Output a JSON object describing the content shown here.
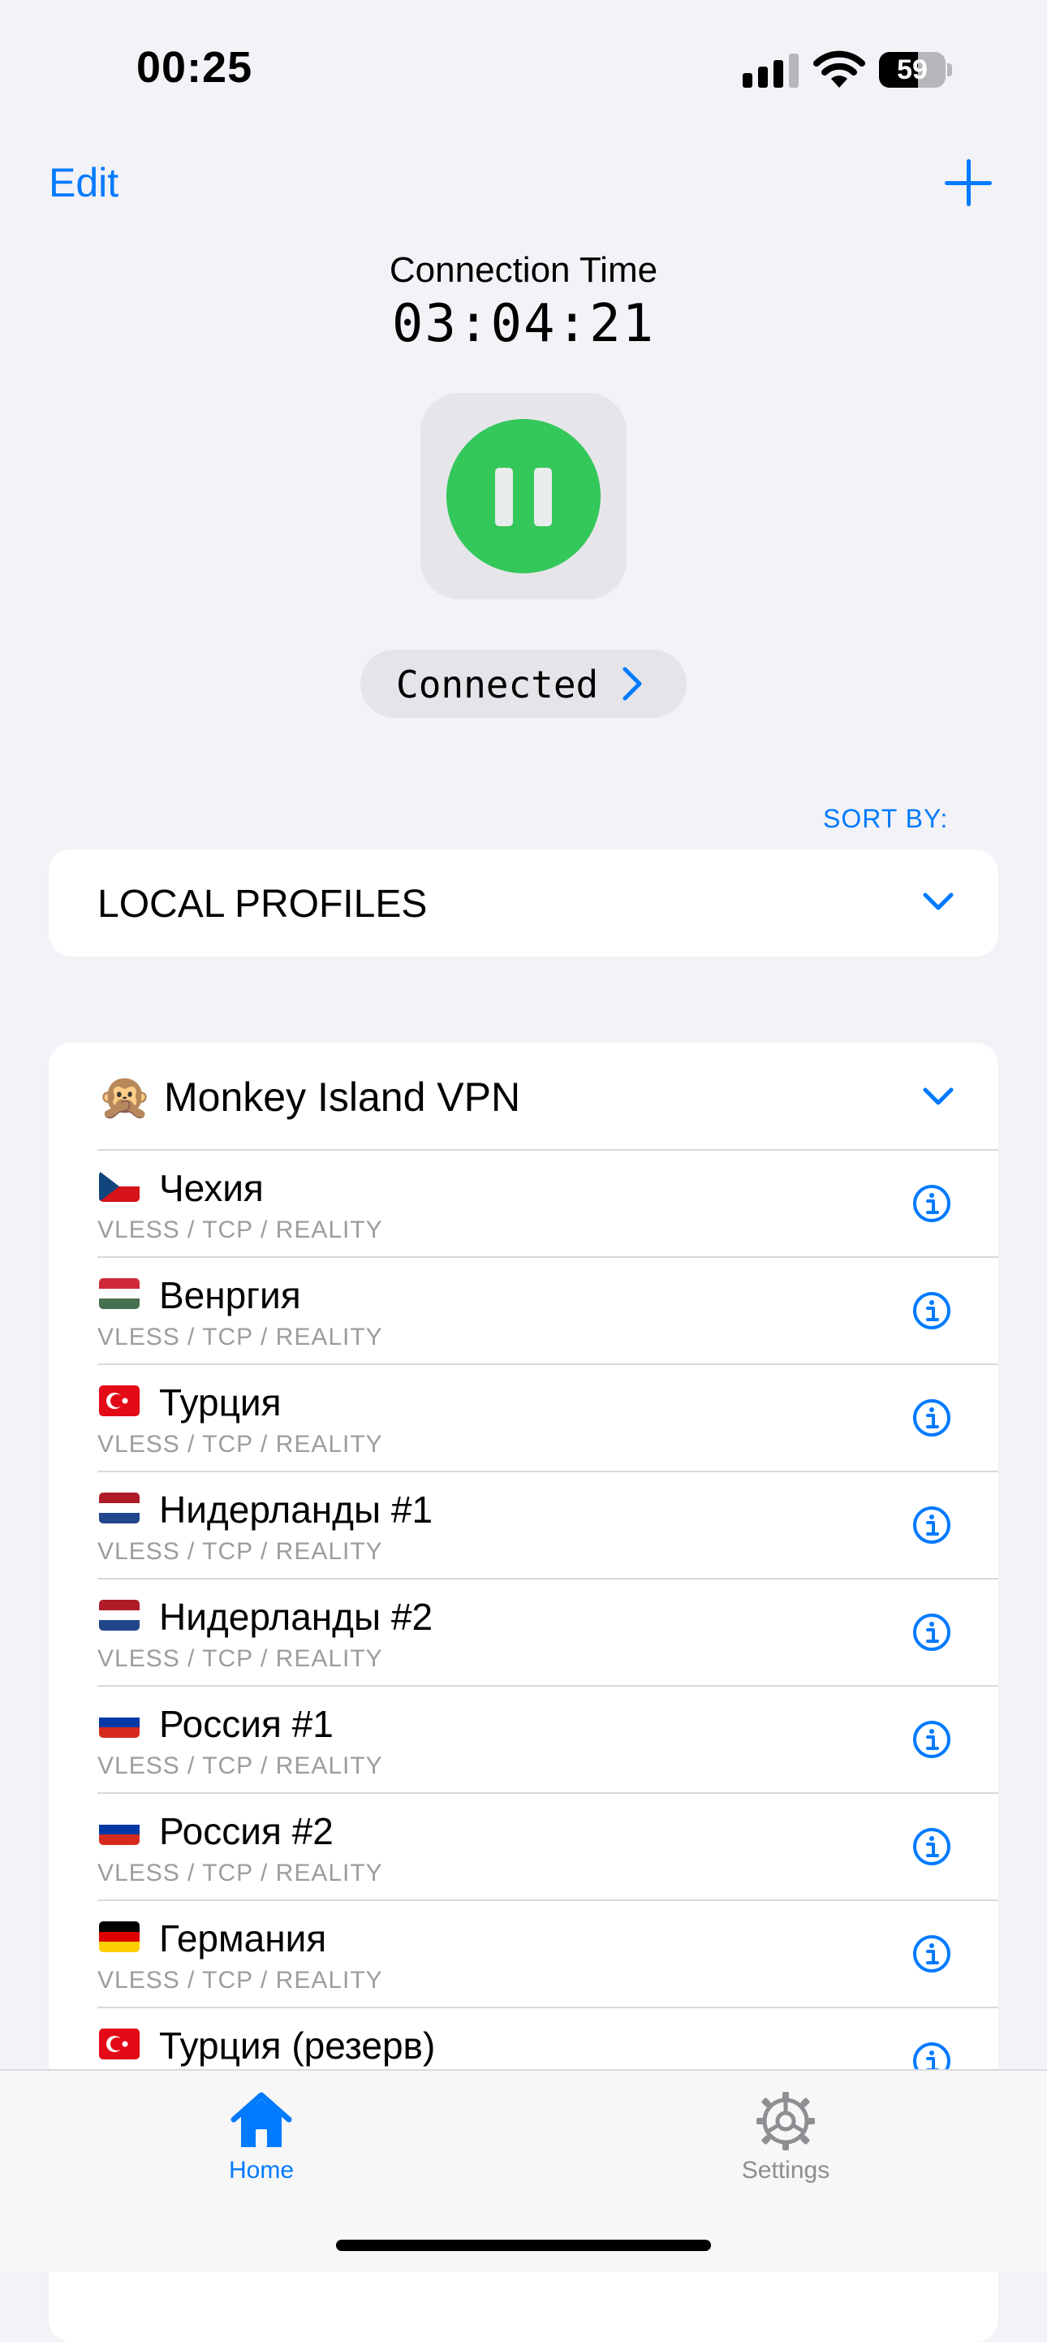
{
  "status_bar": {
    "time": "00:25",
    "battery_percent": 59
  },
  "nav": {
    "edit_label": "Edit"
  },
  "connection": {
    "label": "Connection Time",
    "time": "03:04:21",
    "toggle_state": "connected",
    "toggle_color": "#34c759",
    "status": "Connected"
  },
  "sort_by_label": "SORT BY:",
  "local_profiles": {
    "label": "LOCAL PROFILES"
  },
  "group": {
    "emoji": "🙊",
    "name": "Monkey Island VPN",
    "servers": [
      {
        "flag": "cz",
        "name": "Чехия",
        "protocol": "VLESS / TCP / REALITY"
      },
      {
        "flag": "hu",
        "name": "Венргия",
        "protocol": "VLESS / TCP / REALITY"
      },
      {
        "flag": "tr",
        "name": "Турция",
        "protocol": "VLESS / TCP / REALITY"
      },
      {
        "flag": "nl",
        "name": "Нидерланды #1",
        "protocol": "VLESS / TCP / REALITY"
      },
      {
        "flag": "nl",
        "name": "Нидерланды #2",
        "protocol": "VLESS / TCP / REALITY"
      },
      {
        "flag": "ru",
        "name": "Россия #1",
        "protocol": "VLESS / TCP / REALITY"
      },
      {
        "flag": "ru",
        "name": "Россия #2",
        "protocol": "VLESS / TCP / REALITY"
      },
      {
        "flag": "de",
        "name": "Германия",
        "protocol": "VLESS / TCP / REALITY"
      },
      {
        "flag": "tr",
        "name": "Турция (резерв)",
        "protocol": ""
      }
    ]
  },
  "tab_bar": {
    "tabs": [
      {
        "label": "Home",
        "icon": "house-icon",
        "active": true
      },
      {
        "label": "Settings",
        "icon": "gear-icon",
        "active": false
      }
    ]
  },
  "colors": {
    "accent": "#007aff",
    "background": "#f2f2f7",
    "inactive": "#8e8e93"
  }
}
